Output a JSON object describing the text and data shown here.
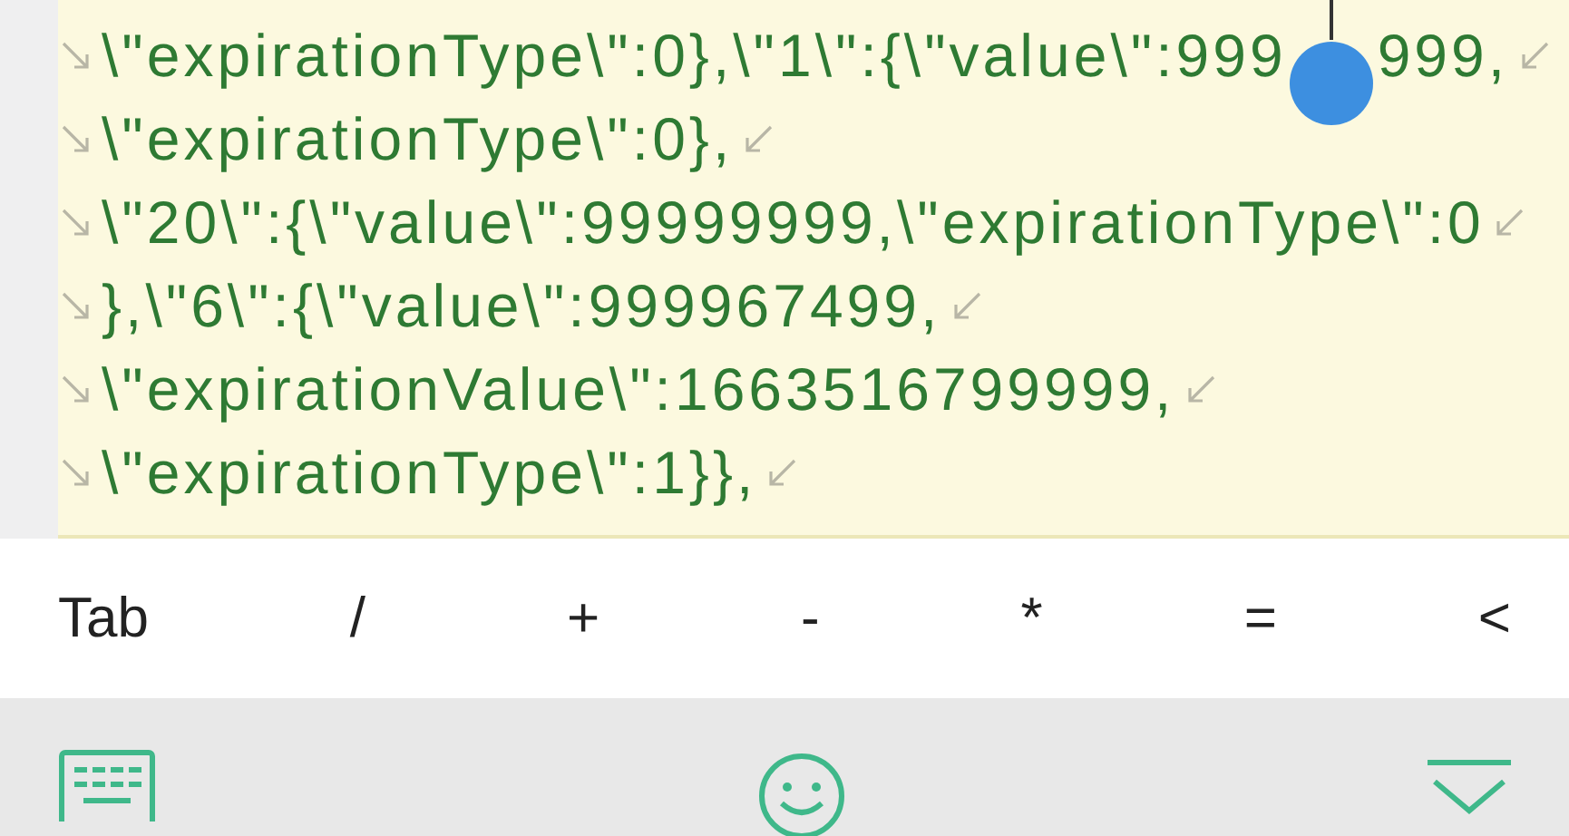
{
  "editor": {
    "lines": [
      {
        "text": "\\\"expirationType\\\":0},\\\"1\\\":{\\\"value\\\":999",
        "text_after_handle": "999,"
      },
      {
        "text": "\\\"expirationType\\\":0},"
      },
      {
        "text": "\\\"20\\\":{\\\"value\\\":99999999,\\\"expirationType\\\":0"
      },
      {
        "text": "},\\\"6\\\":{\\\"value\\\":999967499,"
      },
      {
        "text": "\\\"expirationValue\\\":1663516799999,"
      },
      {
        "text": "\\\"expirationType\\\":1}},"
      }
    ]
  },
  "symbol_keys": [
    "Tab",
    "/",
    "+",
    "-",
    "*",
    "=",
    "<"
  ]
}
